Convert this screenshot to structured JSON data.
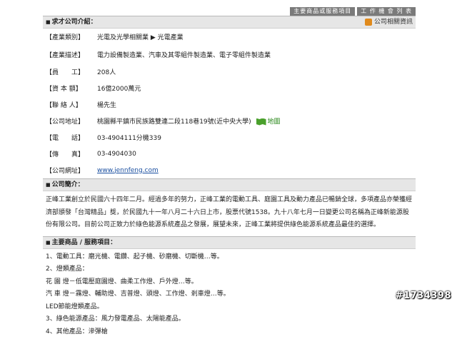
{
  "tabs": [
    "主要商品或服務項目",
    "工 作 機 會 列 表"
  ],
  "company_info": {
    "title": "求才公司介紹：",
    "related_link": "公司相關資訊",
    "rows": [
      {
        "label": "【產業類別】",
        "value": "光電及光學相關業 ▶ 光電產業"
      },
      {
        "label": "【產業描述】",
        "value": "電力設備製造業、汽車及其零組件製造業、電子零組件製造業"
      },
      {
        "label": "【員　　工】",
        "value": "208人"
      },
      {
        "label": "【資 本 額】",
        "value": "16億2000萬元"
      },
      {
        "label": "【聯 絡 人】",
        "value": "楊先生"
      },
      {
        "label": "【公司地址】",
        "value": "桃園縣平鎮市民族路雙連二段118巷19號(近中央大學)",
        "map_label": "地圖"
      },
      {
        "label": "【電　　話】",
        "value": "03-4904111分機339"
      },
      {
        "label": "【傳　　真】",
        "value": "03-4904030"
      },
      {
        "label": "【公司網址】",
        "value": "www.jennfeng.com"
      }
    ]
  },
  "company_intro": {
    "title": "公司簡介：",
    "text": "正峰工業創立於民國六十四年二月。經過多年的努力，正峰工業的電動工具、庭園工具及動力產品已暢銷全球，多項產品亦榮獲經濟部頒發「台灣精品」獎，於民國九十一年八月二十六日上市，股票代號1538。九十八年七月一日變更公司名稱為正峰新能源股份有限公司。目前公司正致力於綠色能源系統產品之發展，展望未來，正峰工業將提供綠色能源系統產品最佳的選擇。"
  },
  "products": {
    "title": "主要商品 / 服務項目：",
    "lines": [
      "1、電動工具：磨光機、電鑽、起子機、砂磨機、切斷機…等。",
      "2、燈類產品：",
      "花 園 燈－低電壓庭園燈、曲柔工作燈、戶外燈…等。",
      "汽 車 燈－霧燈、輔助燈、吉普燈、頭燈、工作燈、剎車燈…等。",
      "LED節能燈類產品。",
      "3、綠色能源產品：風力發電產品、太陽能產品。",
      "4、其他產品：滲彈槍"
    ]
  },
  "watermark": "#1734398",
  "colors": {
    "header_bg": "#e6e6e6",
    "tab_bg": "#7a7a7a",
    "link": "#1a4fa0",
    "map_green": "#4aa02c"
  }
}
